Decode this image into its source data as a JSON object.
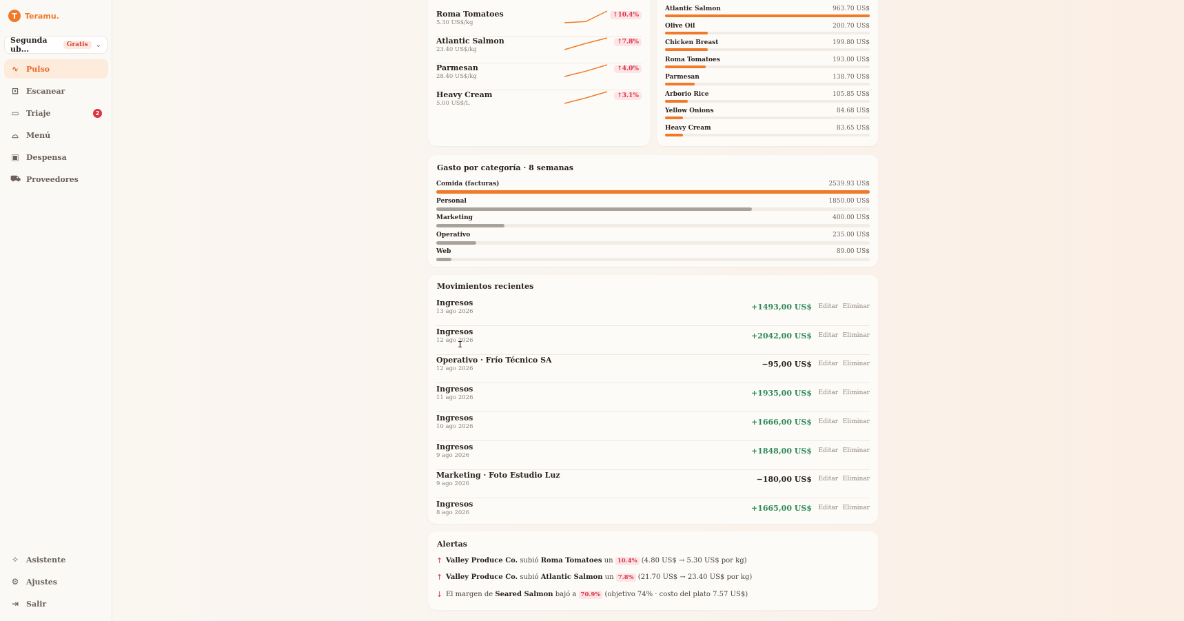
{
  "app": {
    "logo_text": "Teramu."
  },
  "location": {
    "name": "Segunda ub...",
    "plan_badge": "Gratis",
    "chevron": "chevron-down-icon"
  },
  "nav": {
    "items": [
      {
        "label": "Pulso",
        "icon": "pulse-icon",
        "active": true
      },
      {
        "label": "Escanear",
        "icon": "scan-icon"
      },
      {
        "label": "Triaje",
        "icon": "inbox-icon",
        "badge": "2"
      },
      {
        "label": "Menú",
        "icon": "cloche-icon"
      },
      {
        "label": "Despensa",
        "icon": "pantry-icon"
      },
      {
        "label": "Proveedores",
        "icon": "truck-icon"
      }
    ],
    "bottom": [
      {
        "label": "Asistente",
        "icon": "sparkle-icon"
      },
      {
        "label": "Ajustes",
        "icon": "gear-icon"
      },
      {
        "label": "Salir",
        "icon": "logout-icon"
      }
    ]
  },
  "price_trends": [
    {
      "name": "Roma Tomatoes",
      "price": "5.30 US$/kg",
      "change": "↑10.4%",
      "trend": [
        4.8,
        4.85,
        5.3
      ]
    },
    {
      "name": "Atlantic Salmon",
      "price": "23.40 US$/kg",
      "change": "↑7.8%",
      "trend": [
        21.7,
        22.6,
        23.4
      ]
    },
    {
      "name": "Parmesan",
      "price": "28.40 US$/kg",
      "change": "↑4.0%",
      "trend": [
        27.3,
        27.8,
        28.4
      ]
    },
    {
      "name": "Heavy Cream",
      "price": "5.00 US$/L",
      "change": "↑3.1%",
      "trend": [
        4.85,
        4.92,
        5.0
      ]
    }
  ],
  "ingredient_spend": [
    {
      "name": "Atlantic Salmon",
      "value": "963.70 US$",
      "amount": 963.7
    },
    {
      "name": "Olive Oil",
      "value": "200.70 US$",
      "amount": 200.7
    },
    {
      "name": "Chicken Breast",
      "value": "199.80 US$",
      "amount": 199.8
    },
    {
      "name": "Roma Tomatoes",
      "value": "193.00 US$",
      "amount": 193.0
    },
    {
      "name": "Parmesan",
      "value": "138.70 US$",
      "amount": 138.7
    },
    {
      "name": "Arborio Rice",
      "value": "105.85 US$",
      "amount": 105.85
    },
    {
      "name": "Yellow Onions",
      "value": "84.68 US$",
      "amount": 84.68
    },
    {
      "name": "Heavy Cream",
      "value": "83.65 US$",
      "amount": 83.65
    }
  ],
  "category_spend": {
    "title": "Gasto por categoría · 8 semanas",
    "items": [
      {
        "name": "Comida (facturas)",
        "value": "2539.93 US$",
        "amount": 2539.93,
        "color": "#f07a2a"
      },
      {
        "name": "Personal",
        "value": "1850.00 US$",
        "amount": 1850.0,
        "color": "#a8a29c"
      },
      {
        "name": "Marketing",
        "value": "400.00 US$",
        "amount": 400.0,
        "color": "#a8a29c"
      },
      {
        "name": "Operativo",
        "value": "235.00 US$",
        "amount": 235.0,
        "color": "#a8a29c"
      },
      {
        "name": "Web",
        "value": "89.00 US$",
        "amount": 89.0,
        "color": "#a8a29c"
      }
    ]
  },
  "movements": {
    "title": "Movimientos recientes",
    "edit_label": "Editar",
    "delete_label": "Eliminar",
    "rows": [
      {
        "title": "Ingresos",
        "date": "13 ago 2026",
        "amount": "+1493,00 US$",
        "positive": true
      },
      {
        "title": "Ingresos",
        "date": "12 ago 2026",
        "amount": "+2042,00 US$",
        "positive": true
      },
      {
        "title": "Operativo · Frío Técnico SA",
        "date": "12 ago 2026",
        "amount": "−95,00 US$",
        "positive": false
      },
      {
        "title": "Ingresos",
        "date": "11 ago 2026",
        "amount": "+1935,00 US$",
        "positive": true
      },
      {
        "title": "Ingresos",
        "date": "10 ago 2026",
        "amount": "+1666,00 US$",
        "positive": true
      },
      {
        "title": "Ingresos",
        "date": "9 ago 2026",
        "amount": "+1848,00 US$",
        "positive": true
      },
      {
        "title": "Marketing · Foto Estudio Luz",
        "date": "9 ago 2026",
        "amount": "−180,00 US$",
        "positive": false
      },
      {
        "title": "Ingresos",
        "date": "8 ago 2026",
        "amount": "+1665,00 US$",
        "positive": true
      }
    ]
  },
  "alerts": {
    "title": "Alertas",
    "items": [
      {
        "direction": "up",
        "arrow": "↑",
        "parts": [
          {
            "t": "Valley Produce Co.",
            "b": true
          },
          {
            "t": " subió "
          },
          {
            "t": "Roma Tomatoes",
            "b": true
          },
          {
            "t": " un "
          },
          {
            "t": "10.4%",
            "pct": true
          },
          {
            "t": " (4.80 US$ → 5.30 US$ por kg)"
          }
        ]
      },
      {
        "direction": "up",
        "arrow": "↑",
        "parts": [
          {
            "t": "Valley Produce Co.",
            "b": true
          },
          {
            "t": " subió "
          },
          {
            "t": "Atlantic Salmon",
            "b": true
          },
          {
            "t": " un "
          },
          {
            "t": "7.8%",
            "pct": true
          },
          {
            "t": " (21.70 US$ → 23.40 US$ por kg)"
          }
        ]
      },
      {
        "direction": "down",
        "arrow": "↓",
        "parts": [
          {
            "t": "El margen de "
          },
          {
            "t": "Seared Salmon",
            "b": true
          },
          {
            "t": " bajó a "
          },
          {
            "t": "70.9%",
            "pct": true
          },
          {
            "t": " (objetivo 74% · costo del plato 7.57 US$)"
          }
        ]
      }
    ]
  },
  "colors": {
    "accent": "#f07a2a",
    "positive": "#2c8a56",
    "alert": "#d9334a"
  }
}
